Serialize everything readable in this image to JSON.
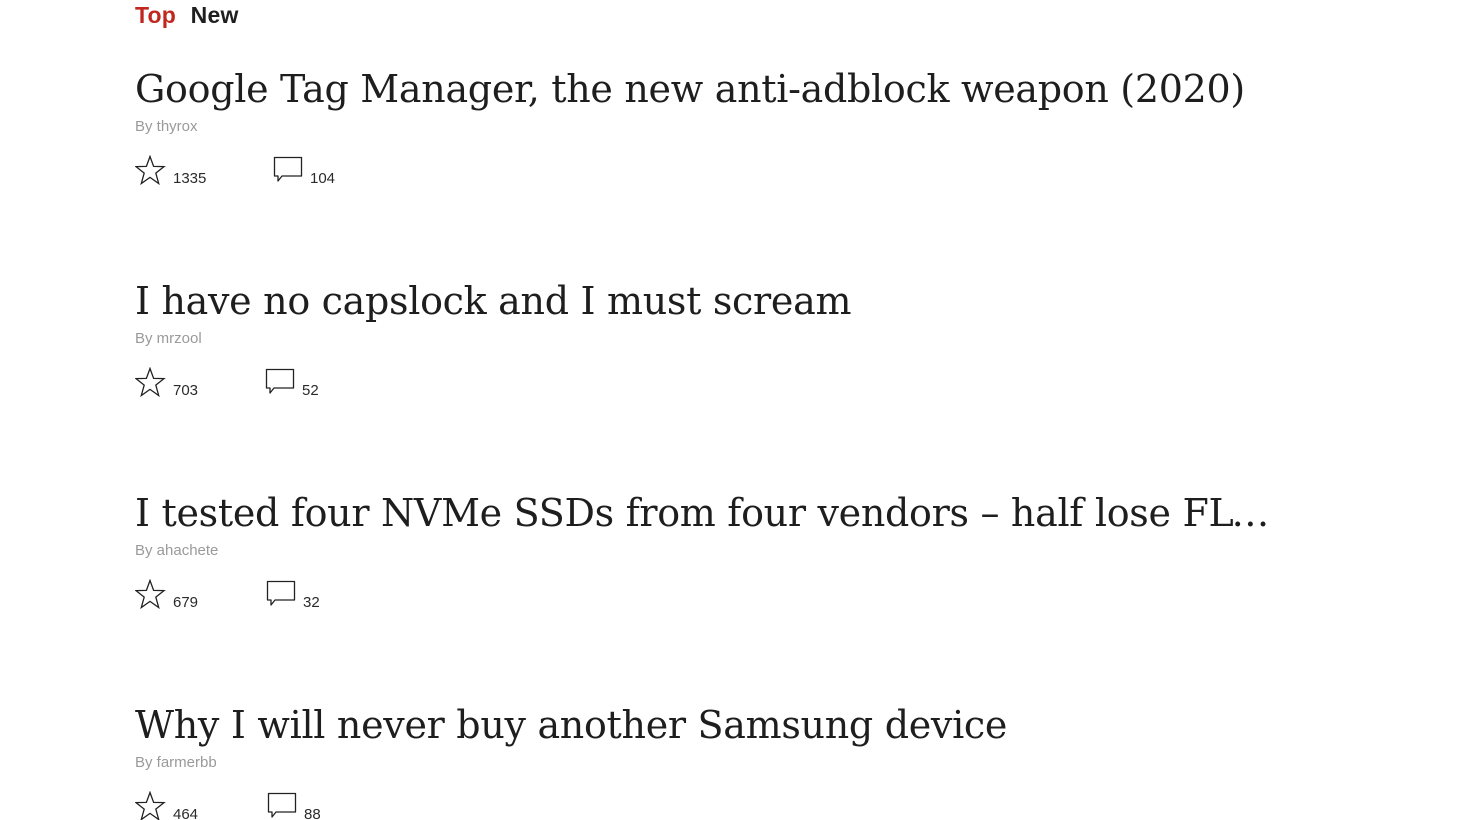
{
  "tabs": [
    {
      "label": "Top",
      "active": true
    },
    {
      "label": "New",
      "active": false
    }
  ],
  "colors": {
    "active_tab": "#c0281f",
    "title": "#1e1e1e",
    "author": "#9a9a9a"
  },
  "stories": [
    {
      "title": "Google Tag Manager, the new anti-adblock weapon (2020)",
      "author": "By thyrox",
      "stars": "1335",
      "comments": "104",
      "star_icon": "star-icon",
      "comment_icon": "comment-icon"
    },
    {
      "title": "I have no capslock and I must scream",
      "author": "By mrzool",
      "stars": "703",
      "comments": "52",
      "star_icon": "star-icon",
      "comment_icon": "comment-icon"
    },
    {
      "title": "I tested four NVMe SSDs from four vendors – half lose FLUSH’…",
      "author": "By ahachete",
      "stars": "679",
      "comments": "32",
      "star_icon": "star-icon",
      "comment_icon": "comment-icon"
    },
    {
      "title": "Why I will never buy another Samsung device",
      "author": "By farmerbb",
      "stars": "464",
      "comments": "88",
      "star_icon": "star-icon",
      "comment_icon": "comment-icon"
    }
  ]
}
